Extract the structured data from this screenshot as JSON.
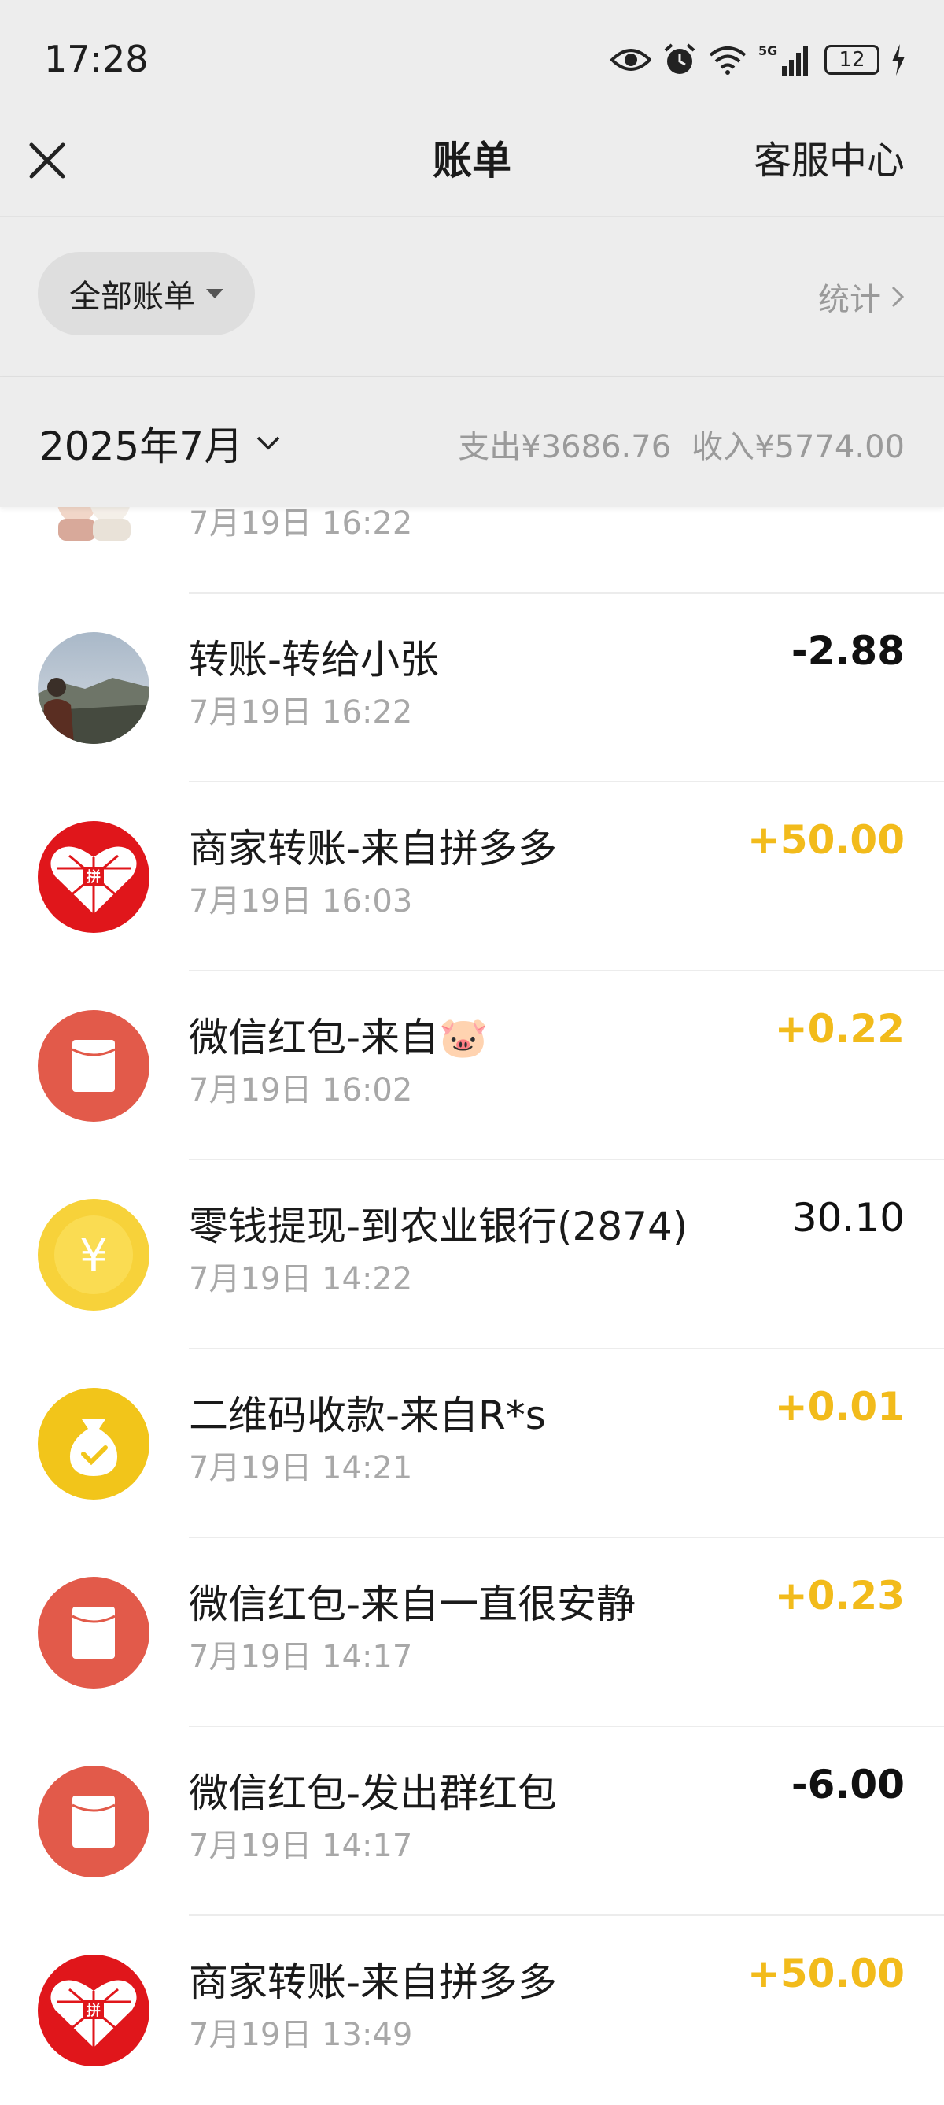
{
  "status_bar": {
    "time": "17:28",
    "signal": "5G",
    "battery": "12"
  },
  "nav": {
    "title": "账单",
    "service": "客服中心"
  },
  "filter": {
    "label": "全部账单",
    "stats": "统计"
  },
  "month_bar": {
    "month": "2025年7月",
    "expense": "支出¥3686.76",
    "income": "收入¥5774.00"
  },
  "transactions": [
    {
      "name": "",
      "date": "7月19日 16:22",
      "amount": "",
      "icon": "sticker-avatar-icon"
    },
    {
      "name": "转账-转给小张",
      "date": "7月19日 16:22",
      "amount": "-2.88",
      "icon": "user-photo-avatar"
    },
    {
      "name": "商家转账-来自拼多多",
      "date": "7月19日 16:03",
      "amount": "+50.00",
      "icon": "pinduoduo-icon"
    },
    {
      "name": "微信红包-来自🐷",
      "date": "7月19日 16:02",
      "amount": "+0.22",
      "icon": "red-packet-icon"
    },
    {
      "name": "零钱提现-到农业银行(2874)",
      "date": "7月19日 14:22",
      "amount": "30.10",
      "icon": "yuan-coin-icon"
    },
    {
      "name": "二维码收款-来自R*s",
      "date": "7月19日 14:21",
      "amount": "+0.01",
      "icon": "money-bag-icon"
    },
    {
      "name": "微信红包-来自一直很安静",
      "date": "7月19日 14:17",
      "amount": "+0.23",
      "icon": "red-packet-icon"
    },
    {
      "name": "微信红包-发出群红包",
      "date": "7月19日 14:17",
      "amount": "-6.00",
      "icon": "red-packet-icon"
    },
    {
      "name": "商家转账-来自拼多多",
      "date": "7月19日 13:49",
      "amount": "+50.00",
      "icon": "pinduoduo-icon"
    }
  ],
  "colors": {
    "positive": "#f2bb1b",
    "negative": "#111111",
    "background": "#ededed",
    "red_packet": "#e25a4a",
    "coin": "#f7d23a",
    "pinduoduo": "#e0161b"
  }
}
